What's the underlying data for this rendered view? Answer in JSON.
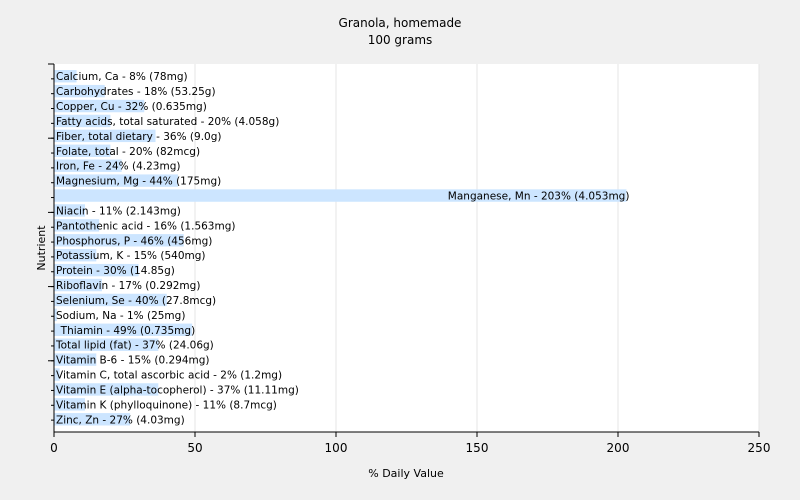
{
  "chart_data": {
    "type": "bar",
    "orientation": "horizontal",
    "title": "Granola, homemade",
    "subtitle": "100 grams",
    "xlabel": "% Daily Value",
    "ylabel": "Nutrient",
    "xlim": [
      0,
      250
    ],
    "xticks": [
      0,
      50,
      100,
      150,
      200,
      250
    ],
    "grid": true,
    "bar_color": "#cce5ff",
    "categories": [
      "Calcium, Ca",
      "Carbohydrates",
      "Copper, Cu",
      "Fatty acids, total saturated",
      "Fiber, total dietary",
      "Folate, total",
      "Iron, Fe",
      "Magnesium, Mg",
      "Manganese, Mn",
      "Niacin",
      "Pantothenic acid",
      "Phosphorus, P",
      "Potassium, K",
      "Protein",
      "Riboflavin",
      "Selenium, Se",
      "Sodium, Na",
      "Thiamin",
      "Total lipid (fat)",
      "Vitamin B-6",
      "Vitamin C, total ascorbic acid",
      "Vitamin E (alpha-tocopherol)",
      "Vitamin K (phylloquinone)",
      "Zinc, Zn"
    ],
    "values": [
      8,
      18,
      32,
      20,
      36,
      20,
      24,
      44,
      203,
      11,
      16,
      46,
      15,
      30,
      17,
      40,
      1,
      49,
      37,
      15,
      2,
      37,
      11,
      27
    ],
    "labels": [
      "Calcium, Ca - 8% (78mg)",
      "Carbohydrates - 18% (53.25g)",
      "Copper, Cu - 32% (0.635mg)",
      "Fatty acids, total saturated - 20% (4.058g)",
      "Fiber, total dietary - 36% (9.0g)",
      "Folate, total - 20% (82mcg)",
      "Iron, Fe - 24% (4.23mg)",
      "Magnesium, Mg - 44% (175mg)",
      "Manganese, Mn - 203% (4.053mg)",
      "Niacin - 11% (2.143mg)",
      "Pantothenic acid - 16% (1.563mg)",
      "Phosphorus, P - 46% (456mg)",
      "Potassium, K - 15% (540mg)",
      "Protein - 30% (14.85g)",
      "Riboflavin - 17% (0.292mg)",
      "Selenium, Se - 40% (27.8mcg)",
      "Sodium, Na - 1% (25mg)",
      "Thiamin - 49% (0.735mg)",
      "Total lipid (fat) - 37% (24.06g)",
      "Vitamin B-6 - 15% (0.294mg)",
      "Vitamin C, total ascorbic acid - 2% (1.2mg)",
      "Vitamin E (alpha-tocopherol) - 37% (11.11mg)",
      "Vitamin K (phylloquinone) - 11% (8.7mcg)",
      "Zinc, Zn - 27% (4.03mg)"
    ]
  }
}
